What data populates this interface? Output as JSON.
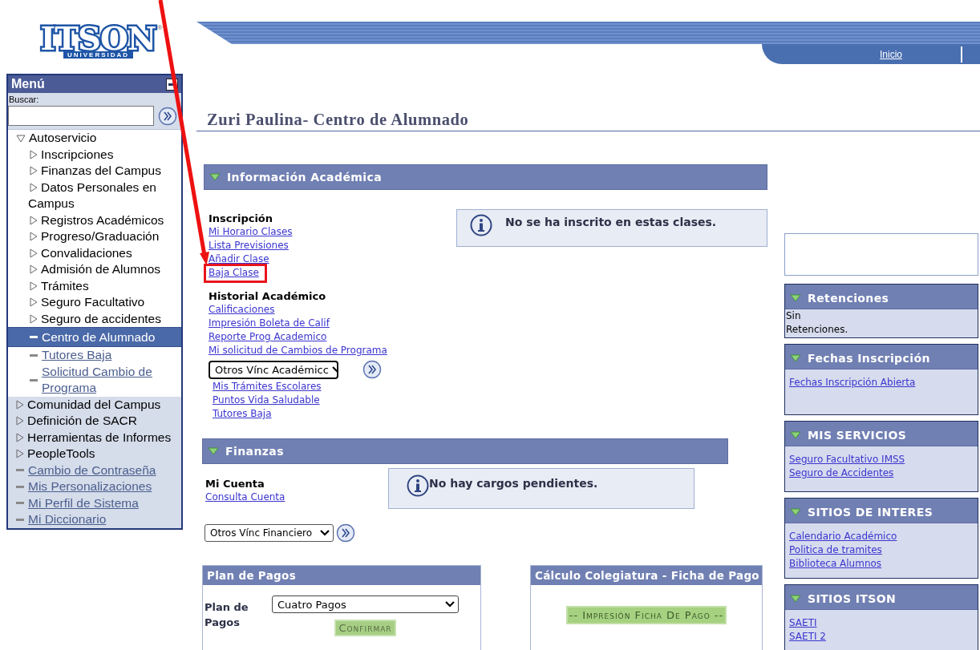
{
  "logo": {
    "text": "ITSON",
    "mark": "®",
    "subtitle": "UNIVERSIDAD"
  },
  "header": {
    "nav_links": [
      {
        "label": "Inicio"
      }
    ]
  },
  "menu": {
    "title": "Menú",
    "search": {
      "label": "Buscar:"
    },
    "tree": [
      {
        "label": "Autoservicio",
        "kind": "folder",
        "expanded": true,
        "children": [
          {
            "label": "Inscripciones",
            "kind": "folder",
            "expanded": false
          },
          {
            "label": "Finanzas del Campus",
            "kind": "folder",
            "expanded": false
          },
          {
            "label": "Datos Personales en Campus",
            "kind": "folder",
            "expanded": false
          },
          {
            "label": "Registros Académicos",
            "kind": "folder",
            "expanded": false
          },
          {
            "label": "Progreso/Graduación",
            "kind": "folder",
            "expanded": false
          },
          {
            "label": "Convalidaciones",
            "kind": "folder",
            "expanded": false
          },
          {
            "label": "Admisión de Alumnos",
            "kind": "folder",
            "expanded": false
          },
          {
            "label": "Trámites",
            "kind": "folder",
            "expanded": false
          },
          {
            "label": "Seguro Facultativo",
            "kind": "folder",
            "expanded": false
          },
          {
            "label": "Seguro de accidentes",
            "kind": "folder",
            "expanded": false
          },
          {
            "label": "Centro de Alumnado",
            "kind": "page",
            "selected": true
          },
          {
            "label": "Tutores Baja",
            "kind": "page",
            "selected": false
          },
          {
            "label": "Solicitud Cambio de Programa",
            "kind": "page",
            "selected": false
          }
        ]
      },
      {
        "label": "Comunidad del Campus",
        "kind": "folder",
        "expanded": false
      },
      {
        "label": "Definición de SACR",
        "kind": "folder",
        "expanded": false
      },
      {
        "label": "Herramientas de Informes",
        "kind": "folder",
        "expanded": false
      },
      {
        "label": "PeopleTools",
        "kind": "folder",
        "expanded": false
      },
      {
        "label": "Cambio de Contraseña",
        "kind": "page",
        "selected": false
      },
      {
        "label": "Mis Personalizaciones",
        "kind": "page",
        "selected": false
      },
      {
        "label": "Mi Perfil de Sistema",
        "kind": "page",
        "selected": false
      },
      {
        "label": "Mi Diccionario",
        "kind": "page",
        "selected": false
      }
    ]
  },
  "page_title": "Zuri Paulina- Centro de Alumnado",
  "academic": {
    "title": "Información Académica",
    "groups": [
      {
        "heading": "Inscripción",
        "links": [
          {
            "label": "Mi Horario Clases",
            "highlighted": false
          },
          {
            "label": "Lista Previsiones",
            "highlighted": false
          },
          {
            "label": "Añadir Clase",
            "highlighted": false
          },
          {
            "label": "Baja Clase",
            "highlighted": true
          }
        ]
      },
      {
        "heading": "Historial Académico",
        "links": [
          {
            "label": "Calificaciones",
            "highlighted": false
          },
          {
            "label": "Impresión Boleta de Calif",
            "highlighted": false
          },
          {
            "label": "Reporte Prog Academico",
            "highlighted": false
          },
          {
            "label": "Mi solicitud de Cambios de Programa",
            "highlighted": false
          }
        ]
      }
    ],
    "dropdown": "Otros Vínc Académicc",
    "more_links": [
      "Mis Trámites Escolares",
      "Puntos Vida Saludable",
      "Tutores Baja"
    ],
    "notice": "No se ha inscrito en estas clases."
  },
  "finances": {
    "title": "Finanzas",
    "heading": "Mi Cuenta",
    "links": [
      "Consulta Cuenta"
    ],
    "notice": "No hay cargos pendientes.",
    "dropdown": "Otros Vínc Financiero"
  },
  "payment_plan": {
    "title": "Plan de Pagos",
    "field_label": "Plan de Pagos",
    "value": "Cuatro Pagos",
    "button": "Confirmar"
  },
  "fee_calculation": {
    "title": "Cálculo Colegiatura - Ficha de Pago",
    "button": "-- Impresión Ficha De Pago --"
  },
  "side_panels": [
    {
      "title": "Retenciones",
      "kind": "text",
      "lines": [
        "Sin",
        "Retenciones."
      ]
    },
    {
      "title": "Fechas Inscripción",
      "kind": "links",
      "links": [
        "Fechas Inscripción Abierta"
      ]
    },
    {
      "title": "MIS SERVICIOS",
      "kind": "links",
      "links": [
        "Seguro Facultativo IMSS",
        "Seguro de Accidentes"
      ]
    },
    {
      "title": "SITIOS DE INTERES",
      "kind": "links",
      "links": [
        "Calendario Académico",
        "Politica de tramites",
        "Biblioteca Alumnos"
      ]
    },
    {
      "title": "SITIOS ITSON",
      "kind": "links",
      "links": [
        "SAETI",
        "SAETI 2"
      ]
    }
  ]
}
